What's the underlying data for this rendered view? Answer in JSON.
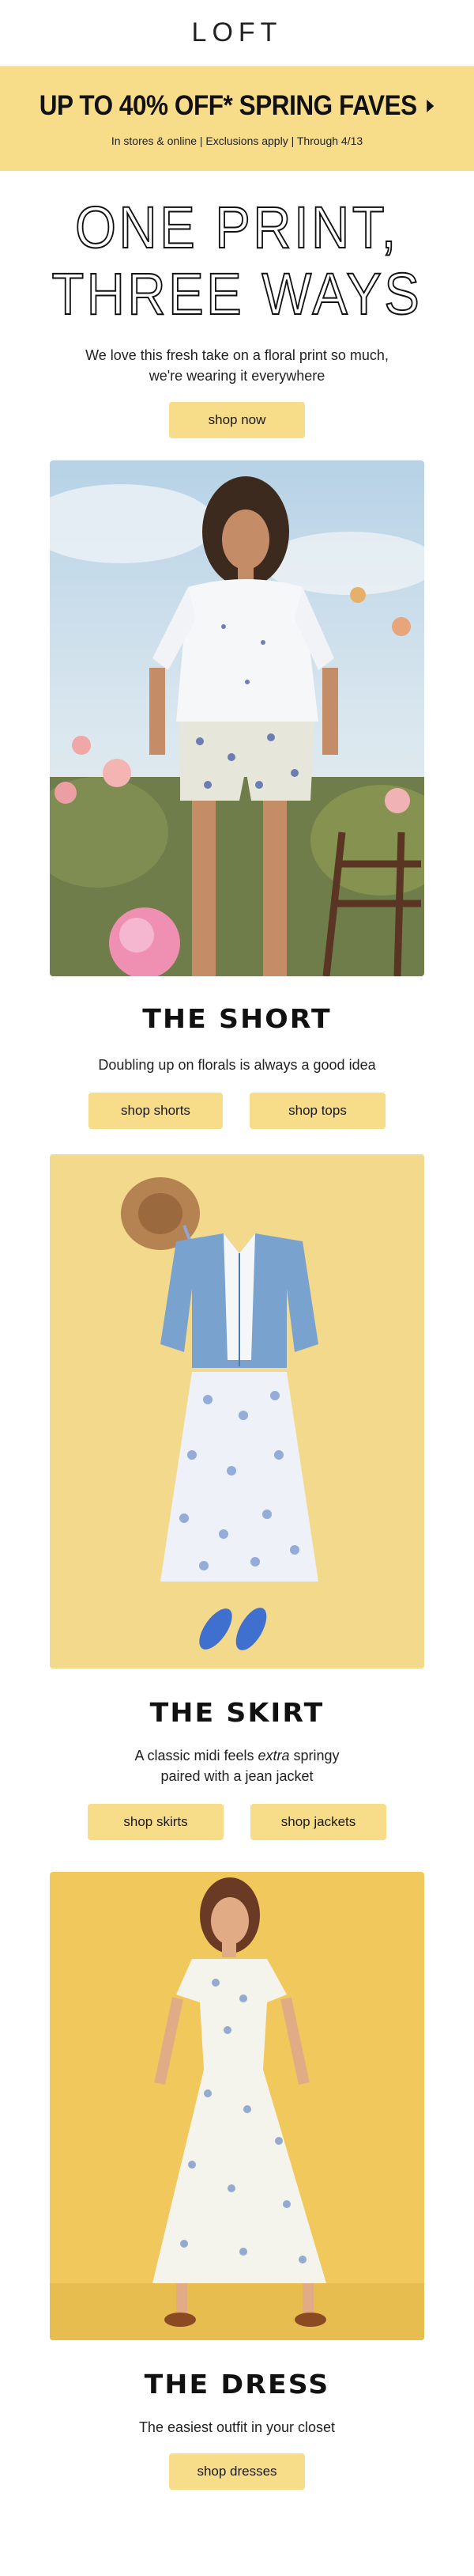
{
  "brand": {
    "logo": "LOFT"
  },
  "promo": {
    "title": "UP TO 40% OFF* SPRING FAVES",
    "subtitle": "In stores & online | Exclusions apply | Through 4/13",
    "bg_color": "#f7dc8a"
  },
  "hero": {
    "line1": "ONE PRINT,",
    "line2": "THREE WAYS",
    "desc_line1": "We love this fresh take on a floral print so much,",
    "desc_line2": "we're wearing it everywhere",
    "button": "shop now"
  },
  "sections": {
    "short": {
      "title": "THE SHORT",
      "subtitle": "Doubling up on florals is always a good idea",
      "btn1": "shop shorts",
      "btn2": "shop tops"
    },
    "skirt": {
      "title": "THE SKIRT",
      "sub_line1_pre": "A classic midi feels ",
      "sub_line1_em": "extra",
      "sub_line1_post": " springy",
      "sub_line2": "paired with a jean jacket",
      "btn1": "shop skirts",
      "btn2": "shop jackets"
    },
    "dress": {
      "title": "THE DRESS",
      "subtitle": "The easiest outfit in your closet",
      "btn1": "shop dresses"
    }
  }
}
